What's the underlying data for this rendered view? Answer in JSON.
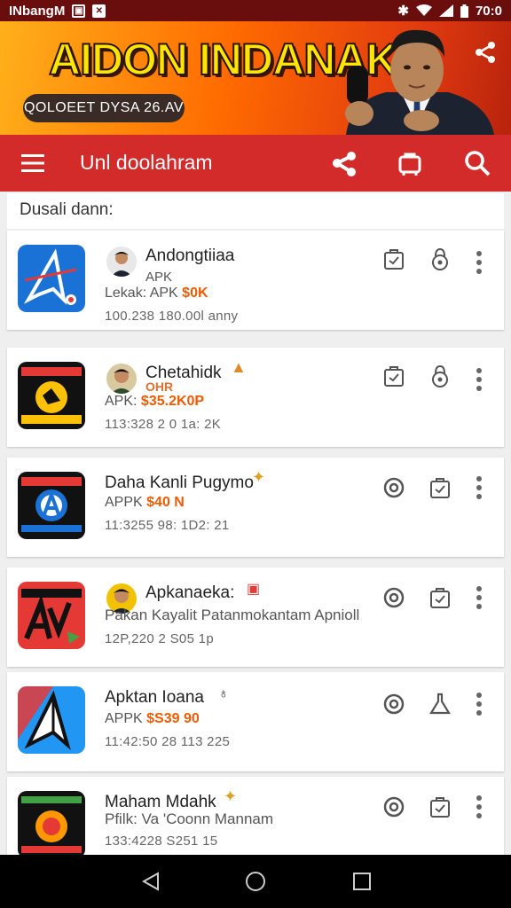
{
  "status_bar": {
    "carrier": "INbangM",
    "time": "70:0",
    "colors": {
      "background": "#6a0d0d"
    }
  },
  "banner": {
    "title": "AIDON INDANAK",
    "pill_text": "QOLOEET DYSA 26.AV",
    "colors": {
      "title": "#ffe500",
      "pill": "#3a2b27"
    }
  },
  "toolbar": {
    "title": "Unl doolahram",
    "icons": [
      "menu-icon",
      "share-icon",
      "bag-icon",
      "search-icon"
    ],
    "colors": {
      "background": "#d32a2a"
    }
  },
  "section": {
    "label": "Dusali dann:"
  },
  "apps": [
    {
      "name": "Andongtiiaa",
      "sub_tag": "APK",
      "line2_prefix": "Lekak: APK",
      "price": "$0K",
      "meta": "100.238 180.00l anny",
      "icon_style": "blue-a",
      "actions": [
        "bag-icon",
        "lock-icon"
      ]
    },
    {
      "name": "Chetahidk",
      "sub_tag": "OHR",
      "line2_prefix": "APK:",
      "price": "$35.2K0P",
      "meta": "113:328 2 0 1a: 2K",
      "icon_style": "black-yellow",
      "actions": [
        "bag-icon",
        "lock-icon"
      ]
    },
    {
      "name": "Daha Kanli Pugymo",
      "sub_tag": "",
      "line2_prefix": "APPK",
      "price": "$40 N",
      "meta": "11:3255 98: 1D2: 21",
      "icon_style": "black-blue",
      "actions": [
        "camera-icon",
        "bag-icon"
      ]
    },
    {
      "name": "Apkanaeka:",
      "sub_tag": "",
      "line2_prefix": "Pakan Kayalit Patanmokantam Apnioll",
      "price": "",
      "meta": "12P,220 2 S05 1p",
      "icon_style": "red-av",
      "actions": [
        "camera-icon",
        "bag-icon"
      ]
    },
    {
      "name": "Apktan Ioana",
      "sub_tag": "",
      "line2_prefix": "APPK",
      "price": "$S39 90",
      "meta": "11:42:50 28 113 225",
      "icon_style": "white-a",
      "actions": [
        "camera-icon",
        "flask-icon"
      ]
    },
    {
      "name": "Maham Mdahk",
      "sub_tag": "",
      "line2_prefix": "Pfilk: Va 'Coonn Mannam",
      "price": "",
      "meta": "133:4228 S251 15",
      "icon_style": "black-green",
      "actions": [
        "camera-icon",
        "bag-icon"
      ]
    }
  ],
  "nav_bar": {
    "buttons": [
      "back-icon",
      "home-icon",
      "recents-icon"
    ]
  }
}
